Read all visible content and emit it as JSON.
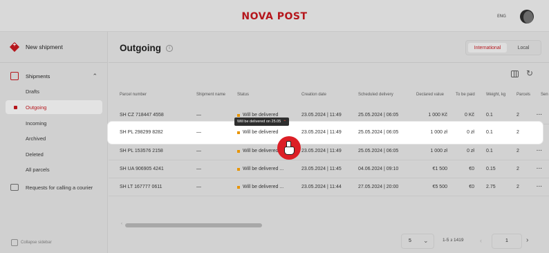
{
  "header": {
    "logo": "NOVA POST",
    "lang": "ENG"
  },
  "sidebar": {
    "new_shipment": "New shipment",
    "shipments": "Shipments",
    "items": [
      {
        "label": "Drafts"
      },
      {
        "label": "Outgoing"
      },
      {
        "label": "Incoming"
      },
      {
        "label": "Archived"
      },
      {
        "label": "Deleted"
      },
      {
        "label": "All parcels"
      }
    ],
    "courier": "Requests for calling a courier",
    "collapse": "Collapse sidebar"
  },
  "main": {
    "title": "Outgoing",
    "toggle": {
      "international": "International",
      "local": "Local"
    },
    "columns": [
      "Parcel number",
      "Shipment name",
      "Status",
      "Creation date",
      "Scheduled delivery",
      "Declared value",
      "To be paid",
      "Weight, kg",
      "Parcels",
      "Sen"
    ],
    "rows": [
      {
        "parcel": "SH CZ 718447 4558",
        "name": "—",
        "status": "Will be delivered",
        "created": "23.05.2024 | 11:49",
        "scheduled": "25.05.2024 | 06:05",
        "declared": "1 000 Kč",
        "to_pay": "0 Kč",
        "weight": "0.1",
        "parcels": "2",
        "more": "···"
      },
      {
        "parcel": "SH PL 298299 8282",
        "name": "—",
        "status": "Will be delivered",
        "created": "23.05.2024 | 11:49",
        "scheduled": "25.05.2024 | 06:05",
        "declared": "1 000 zł",
        "to_pay": "0 zł",
        "weight": "0.1",
        "parcels": "2",
        "more": "···"
      },
      {
        "parcel": "SH PL 153576 2158",
        "name": "—",
        "status": "Will be delivered ...",
        "created": "23.05.2024 | 11:49",
        "scheduled": "25.05.2024 | 06:05",
        "declared": "1 000 zł",
        "to_pay": "0 zł",
        "weight": "0.1",
        "parcels": "2",
        "more": "···"
      },
      {
        "parcel": "SH UA 906905 4241",
        "name": "—",
        "status": "Will be delivered ...",
        "created": "23.05.2024 | 11:45",
        "scheduled": "04.06.2024 | 09:10",
        "declared": "€1 500",
        "to_pay": "€0",
        "weight": "0.15",
        "parcels": "2",
        "more": "···"
      },
      {
        "parcel": "SH LT 167777 0611",
        "name": "—",
        "status": "Will be delivered ...",
        "created": "23.05.2024 | 11:44",
        "scheduled": "27.05.2024 | 20:00",
        "declared": "€5 500",
        "to_pay": "€0",
        "weight": "2.75",
        "parcels": "2",
        "more": "···"
      }
    ],
    "tooltip": "Will be delivered on 25.05"
  },
  "pagination": {
    "page_size": "5",
    "range": "1-5 з 1419",
    "page": "1",
    "prev": "‹",
    "next": "›",
    "chevron": "⌄"
  },
  "icons": {
    "info": "i",
    "refresh": "↻",
    "chevron_up": "⌃",
    "scroll_left": "‹"
  },
  "colors": {
    "accent": "#b5161c",
    "status": "#e89400"
  }
}
